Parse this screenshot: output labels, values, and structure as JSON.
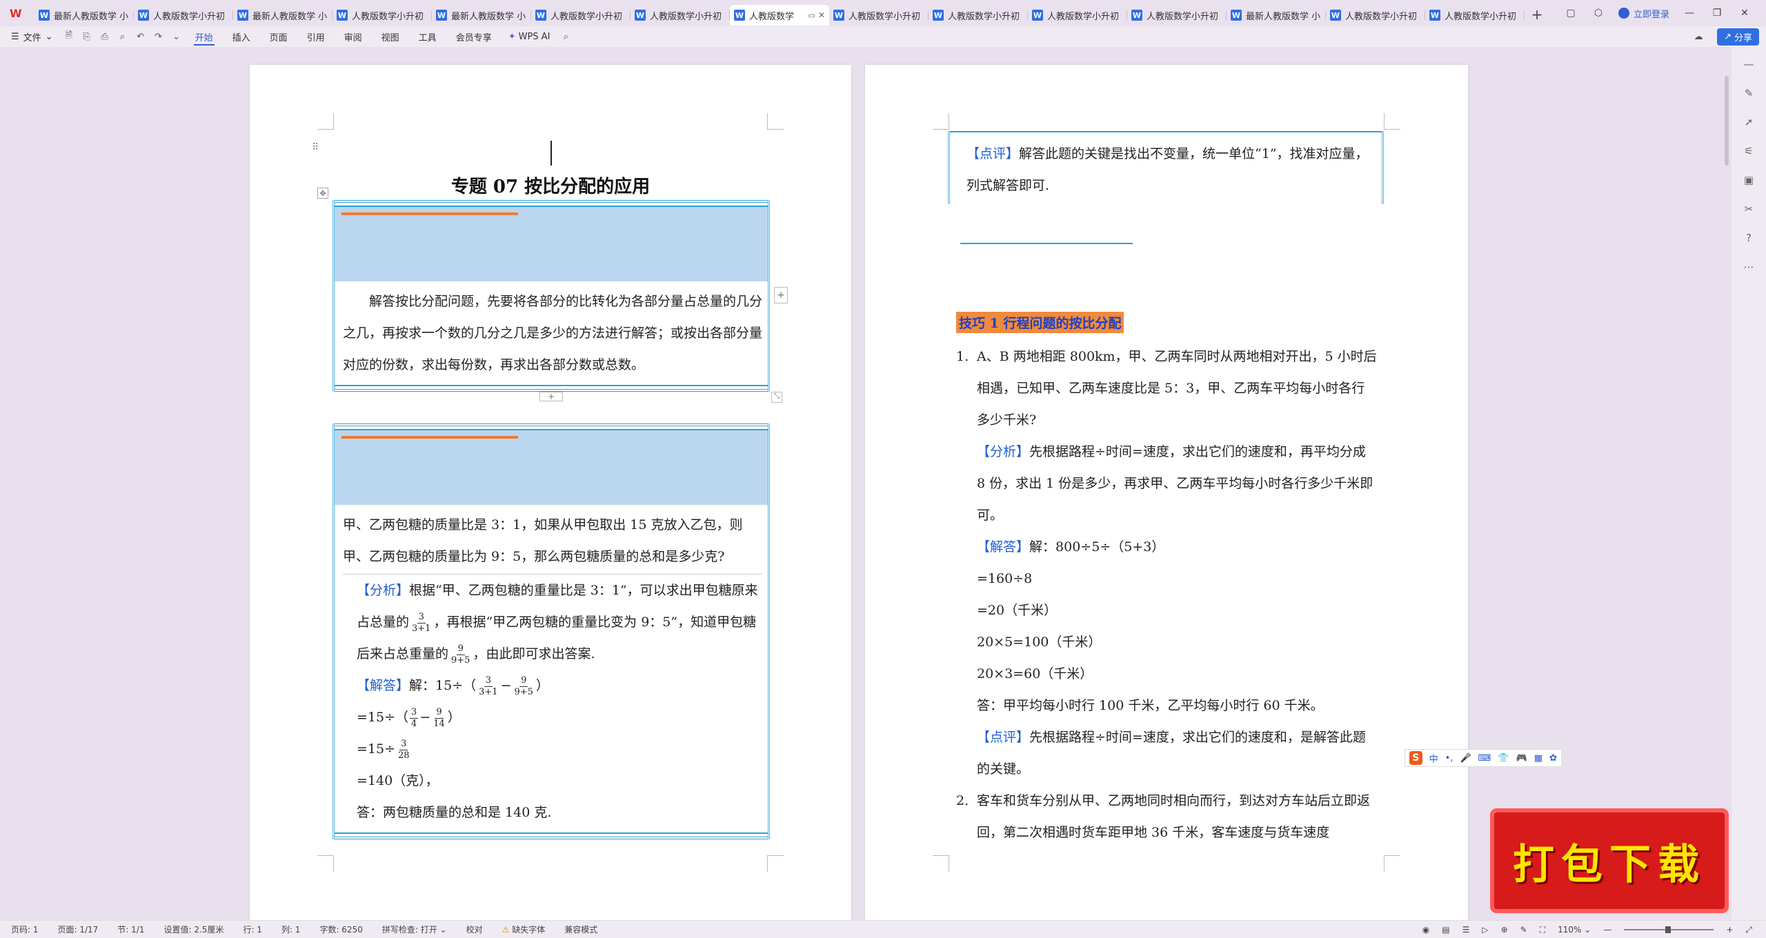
{
  "tabs": [
    {
      "label": "最新人教版数学 小"
    },
    {
      "label": "人教版数学小升初"
    },
    {
      "label": "最新人教版数学 小"
    },
    {
      "label": "人教版数学小升初"
    },
    {
      "label": "最新人教版数学 小"
    },
    {
      "label": "人教版数学小升初"
    },
    {
      "label": "人教版数学小升初"
    },
    {
      "label": "人教版数学"
    },
    {
      "label": "人教版数学小升初"
    },
    {
      "label": "人教版数学小升初"
    },
    {
      "label": "人教版数学小升初"
    },
    {
      "label": "人教版数学小升初"
    },
    {
      "label": "最新人教版数学 小"
    },
    {
      "label": "人教版数学小升初"
    },
    {
      "label": "人教版数学小升初"
    }
  ],
  "header": {
    "login": "立即登录",
    "share": "分享"
  },
  "toolbar": {
    "file": "文件",
    "menus": [
      "开始",
      "插入",
      "页面",
      "引用",
      "审阅",
      "视图",
      "工具",
      "会员专享"
    ],
    "wps_ai": "WPS AI"
  },
  "left_page": {
    "title": "专题 07  按比分配的应用",
    "box1": {
      "text": "解答按比分配问题，先要将各部分的比转化为各部分量占总量的几分之几，再按求一个数的几分之几是多少的方法进行解答；或按出各部分量对应的份数，求出每份数，再求出各部分数或总数。"
    },
    "box2": {
      "question": "甲、乙两包糖的质量比是 3：1，如果从甲包取出 15 克放入乙包，则甲、乙两包糖的质量比为 9：5，那么两包糖质量的总和是多少克?",
      "analysis_tag": "【分析】",
      "analysis_a": "根据“甲、乙两包糖的重量比是 3：1”，可以求出甲包糖原来占总量的",
      "f1_num": "3",
      "f1_den": "3+1",
      "analysis_b": "，再根据“甲乙两包糖的重量比变为 9：5”，知道甲包糖后来占总重量的",
      "f2_num": "9",
      "f2_den": "9+5",
      "analysis_c": "，由此即可求出答案.",
      "answer_tag": "【解答】",
      "answer_a": "解：15÷（",
      "answer_b": "−",
      "answer_c": "）",
      "line2_a": "=15÷（",
      "f3_num": "3",
      "f3_den": "4",
      "f4_num": "9",
      "f4_den": "14",
      "line2_b": "）",
      "line3_a": "=15÷",
      "f5_num": "3",
      "f5_den": "28",
      "line4": "=140（克），",
      "line5": "答：两包糖质量的总和是 140 克."
    }
  },
  "right_page": {
    "comment_tag": "【点评】",
    "comment_text": "解答此题的关键是找出不变量，统一单位“1”，找准对应量，列式解答即可.",
    "skill_title": "技巧 1  行程问题的按比分配",
    "q1_num": "1.",
    "q1_text": "A、B 两地相距 800km，甲、乙两车同时从两地相对开出，5 小时后相遇，已知甲、乙两车速度比是 5：3，甲、乙两车平均每小时各行多少千米?",
    "q1_analysis_tag": "【分析】",
    "q1_analysis": "先根据路程÷时间=速度，求出它们的速度和，再平均分成 8 份，求出 1 份是多少，再求甲、乙两车平均每小时各行多少千米即可。",
    "q1_answer_tag": "【解答】",
    "q1_answer": "解：800÷5÷（5+3）",
    "q1_l2": "=160÷8",
    "q1_l3": "=20（千米）",
    "q1_l4": "20×5=100（千米）",
    "q1_l5": "20×3=60（千米）",
    "q1_l6": "答：甲平均每小时行 100 千米，乙平均每小时行 60 千米。",
    "q1_comment_tag": "【点评】",
    "q1_comment": "先根据路程÷时间=速度，求出它们的速度和，是解答此题的关键。",
    "q2_num": "2.",
    "q2_text": "客车和货车分别从甲、乙两地同时相向而行，到达对方车站后立即返回，第二次相遇时货车距甲地 36 千米，客车速度与货车速度"
  },
  "ime": {
    "label": "中"
  },
  "download": "打包下载",
  "status": {
    "page_no": "页码: 1",
    "pages": "页面: 1/17",
    "section": "节: 1/1",
    "setting": "设置值: 2.5厘米",
    "row": "行: 1",
    "col": "列: 1",
    "words": "字数: 6250",
    "spell": "拼写检查: 打开",
    "proof": "校对",
    "missing_font": "缺失字体",
    "compat": "兼容模式",
    "zoom": "110%"
  }
}
